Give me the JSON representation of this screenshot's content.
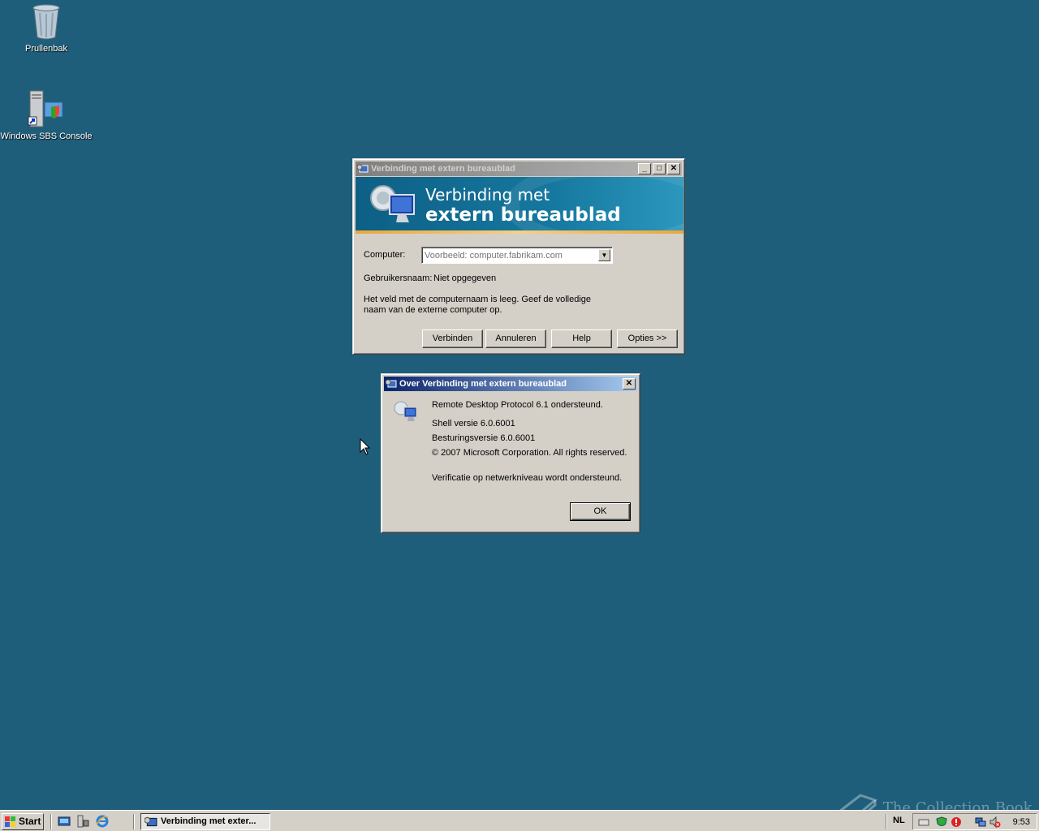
{
  "desktop": {
    "icons": [
      {
        "label": "Prullenbak"
      },
      {
        "label": "Windows SBS Console"
      }
    ],
    "watermark": "The Collection Book"
  },
  "rdp_window": {
    "title": "Verbinding met extern bureaublad",
    "banner_line1": "Verbinding met",
    "banner_line2": "extern bureaublad",
    "computer_label": "Computer:",
    "computer_placeholder": "Voorbeeld: computer.fabrikam.com",
    "username_label": "Gebruikersnaam:",
    "username_value": "Niet opgegeven",
    "message_line1": "Het veld met de computernaam is leeg. Geef de volledige",
    "message_line2": "naam van de externe computer op.",
    "buttons": {
      "connect": "Verbinden",
      "cancel": "Annuleren",
      "help": "Help",
      "options": "Opties >>"
    }
  },
  "about_dialog": {
    "title": "Over Verbinding met extern bureaublad",
    "line1": "Remote Desktop Protocol 6.1 ondersteund.",
    "line2": "Shell versie 6.0.6001",
    "line3": "Besturingsversie 6.0.6001",
    "line4": "© 2007 Microsoft Corporation. All rights reserved.",
    "line5": "Verificatie op netwerkniveau wordt ondersteund.",
    "ok": "OK"
  },
  "taskbar": {
    "start": "Start",
    "task_button": "Verbinding met exter...",
    "language": "NL",
    "clock": "9:53"
  },
  "colors": {
    "desktop": "#1f5e7a",
    "banner": "#16789f",
    "active_title": "#0a246a"
  }
}
